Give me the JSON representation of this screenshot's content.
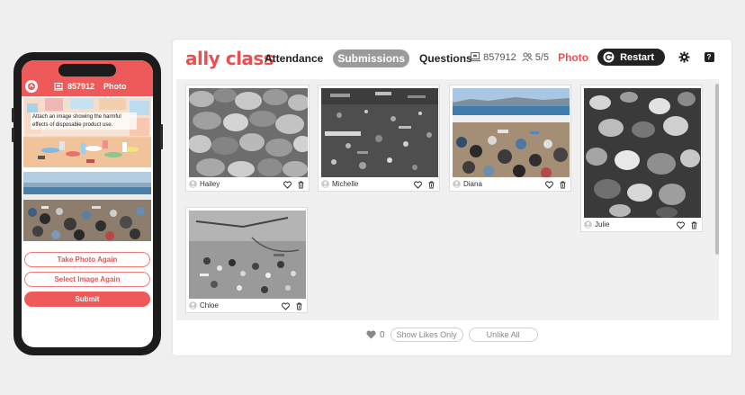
{
  "phone": {
    "session_code": "857912",
    "activity_type": "Photo",
    "prompt_text": "Attach an image showing the harmful effects of disposable product use.",
    "buttons": {
      "take_photo": "Take Photo Again",
      "select_image": "Select Image Again",
      "submit": "Submit"
    }
  },
  "app": {
    "brand": "ally class",
    "nav": [
      {
        "label": "Attendance",
        "active": false
      },
      {
        "label": "Submissions",
        "active": true
      },
      {
        "label": "Questions",
        "active": false
      }
    ],
    "session_code": "857912",
    "participants": "5/5",
    "activity_type": "Photo",
    "restart_label": "Restart",
    "help_label": "?",
    "submissions": [
      {
        "name": "Hailey",
        "photo": "grayscale crumpled plastic bags"
      },
      {
        "name": "Michelle",
        "photo": "grayscale litter on dark sand"
      },
      {
        "name": "Diana",
        "photo": "color beach covered with trash"
      },
      {
        "name": "Julie",
        "photo": "grayscale pile of plastic bottles"
      },
      {
        "name": "Chloe",
        "photo": "grayscale debris on sand"
      }
    ],
    "footer": {
      "like_count": "0",
      "show_likes_only": "Show Likes Only",
      "unlike_all": "Unlike All"
    }
  },
  "colors": {
    "brand_red": "#ee4e4e",
    "phone_accent": "#ee5a5a",
    "active_tab": "#9a9a9a",
    "dark_button": "#222222"
  }
}
